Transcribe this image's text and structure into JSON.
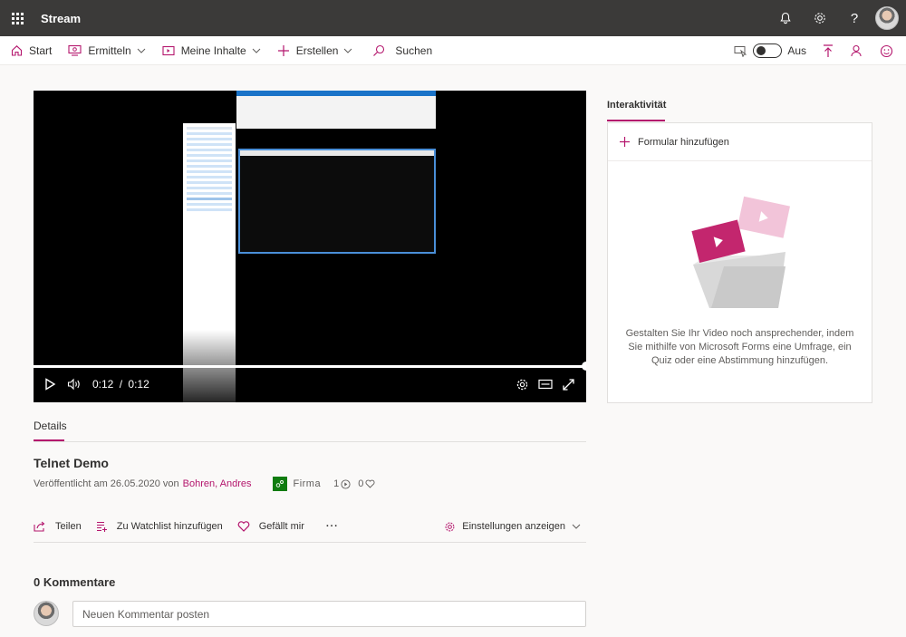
{
  "app": {
    "title": "Stream"
  },
  "header": {
    "icons": [
      "waffle-icon",
      "bell-icon",
      "gear-icon",
      "help-icon",
      "avatar"
    ],
    "help_glyph": "?"
  },
  "commandbar": {
    "start": "Start",
    "discover": "Ermitteln",
    "my_content": "Meine Inhalte",
    "create": "Erstellen",
    "search": "Suchen",
    "toggle_label": "Aus",
    "toggle_state": "off"
  },
  "player": {
    "current_time": "0:12",
    "separator": "/",
    "duration": "0:12",
    "progress": 1.0
  },
  "details": {
    "tab": "Details",
    "title": "Telnet Demo",
    "published_prefix": "Veröffentlicht am 26.05.2020 von",
    "author": "Bohren, Andres",
    "org": "Firma",
    "views": "1",
    "likes": "0"
  },
  "actions": {
    "share": "Teilen",
    "watchlist": "Zu Watchlist hinzufügen",
    "like": "Gefällt mir",
    "more": "···",
    "settings": "Einstellungen anzeigen"
  },
  "comments": {
    "heading": "0 Kommentare",
    "placeholder": "Neuen Kommentar posten"
  },
  "interactivity": {
    "tab": "Interaktivität",
    "add_form": "Formular hinzufügen",
    "description": "Gestalten Sie Ihr Video noch ansprechender, indem Sie mithilfe von Microsoft Forms eine Umfrage, ein Quiz oder eine Abstimmung hinzufügen."
  },
  "colors": {
    "accent": "#b4166d",
    "topbar": "#3b3a39",
    "org_badge": "#107c10"
  }
}
